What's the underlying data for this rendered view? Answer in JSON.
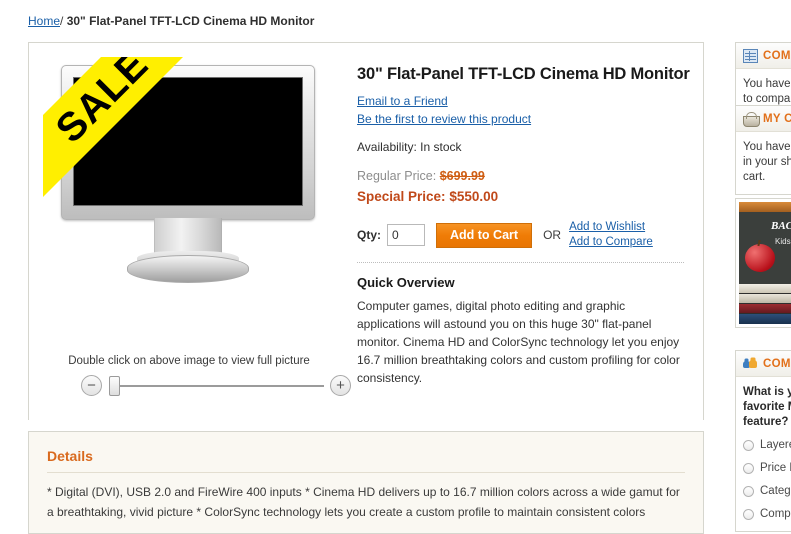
{
  "breadcrumb": {
    "home_label": "Home",
    "separator": "/",
    "current": "30\" Flat-Panel TFT-LCD Cinema HD Monitor"
  },
  "product": {
    "title": "30\" Flat-Panel TFT-LCD Cinema HD Monitor",
    "email_friend_label": "Email to a Friend",
    "review_label": "Be the first to review this product",
    "availability": "Availability: In stock",
    "regular_price_label": "Regular Price:",
    "regular_price": "$699.99",
    "special_price_label": "Special Price:",
    "special_price": "$550.00",
    "qty_label": "Qty:",
    "qty_value": "0",
    "qty_placeholder": "",
    "add_to_cart_label": "Add to Cart",
    "or_label": "OR",
    "wishlist_label": "Add to Wishlist",
    "compare_label": "Add to Compare",
    "quick_overview_title": "Quick Overview",
    "quick_overview_body": "Computer games, digital photo editing and graphic applications will astound you on this huge 30\" flat-panel monitor. Cinema HD and ColorSync technology let you enjoy 16.7 million breathtaking colors and custom profiling for color consistency.",
    "sale_badge": "SALE",
    "zoom_hint": "Double click on above image to view full picture",
    "zoom_out_icon": "minus-icon",
    "zoom_in_icon": "plus-icon"
  },
  "details": {
    "title": "Details",
    "body": "* Digital (DVI), USB 2.0 and FireWire 400 inputs * Cinema HD delivers up to 16.7 million colors across a wide gamut for a breathtaking, vivid picture * ColorSync technology lets you create a custom profile to maintain consistent colors"
  },
  "sidebar": {
    "compare_block": {
      "icon": "grid-icon",
      "title": "COMPARE PRODUCTS",
      "body": "You have no items to compare."
    },
    "cart_block": {
      "icon": "basket-icon",
      "title": "MY CART",
      "body": "You have no items in your shopping cart."
    },
    "banner": {
      "icon": "back-to-school-banner",
      "headline": "BACK",
      "subtext": "Kids love\nfor school"
    },
    "poll_block": {
      "icon": "community-poll-icon",
      "title": "COMMUNITY POLL",
      "question": "What is your favorite Magento feature?",
      "options": [
        "Layered Navigation",
        "Price Rules",
        "Category Management",
        "Compare Products"
      ]
    }
  },
  "colors": {
    "accent_orange": "#e2701a",
    "link_blue": "#1a5fa8",
    "special_price_red": "#c0491a",
    "sale_yellow": "#ffef00",
    "button_orange": "#ef7c06"
  }
}
